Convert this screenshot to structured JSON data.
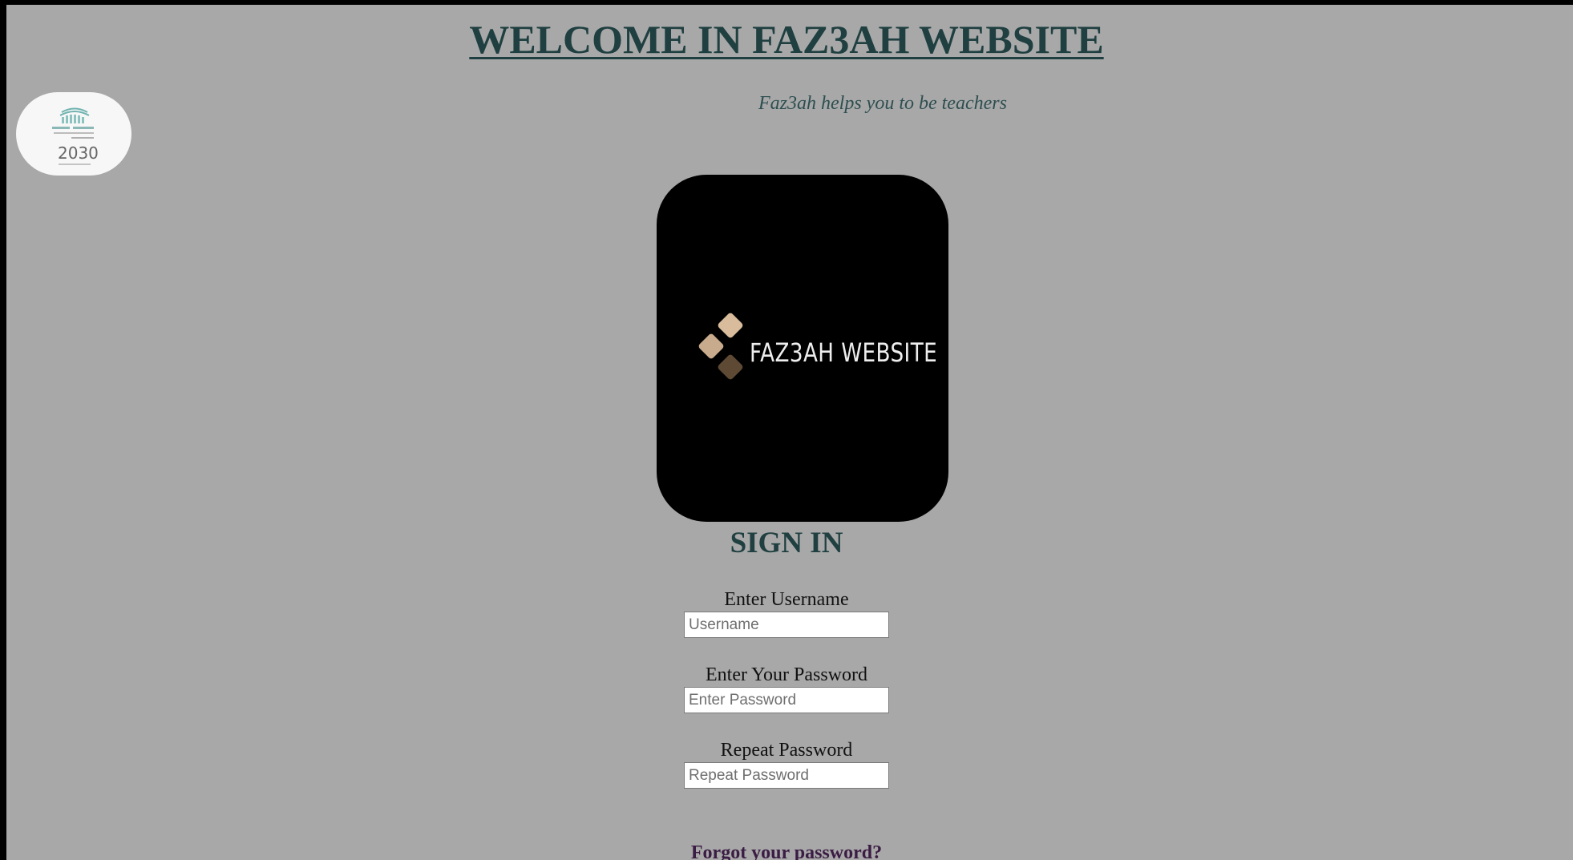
{
  "header": {
    "title": "WELCOME IN FAZ3AH WEBSITE",
    "tagline": "Faz3ah helps you to be teachers"
  },
  "logo": {
    "text": "FAZ3AH WEBSITE"
  },
  "badge": {
    "year_text": "2030"
  },
  "form": {
    "heading": "SIGN IN",
    "username": {
      "label": "Enter Username",
      "placeholder": "Username"
    },
    "password": {
      "label": "Enter Your Password",
      "placeholder": "Enter Password"
    },
    "repeat_password": {
      "label": "Repeat Password",
      "placeholder": "Repeat Password"
    },
    "forgot_link": "Forgot your password?"
  },
  "colors": {
    "background": "#a8a8a8",
    "heading": "#1f3f40",
    "logo_card": "#000000",
    "diamond_light": "#d8bc9c",
    "diamond_mid": "#c8ab8c",
    "diamond_dark": "#5e4a34"
  }
}
